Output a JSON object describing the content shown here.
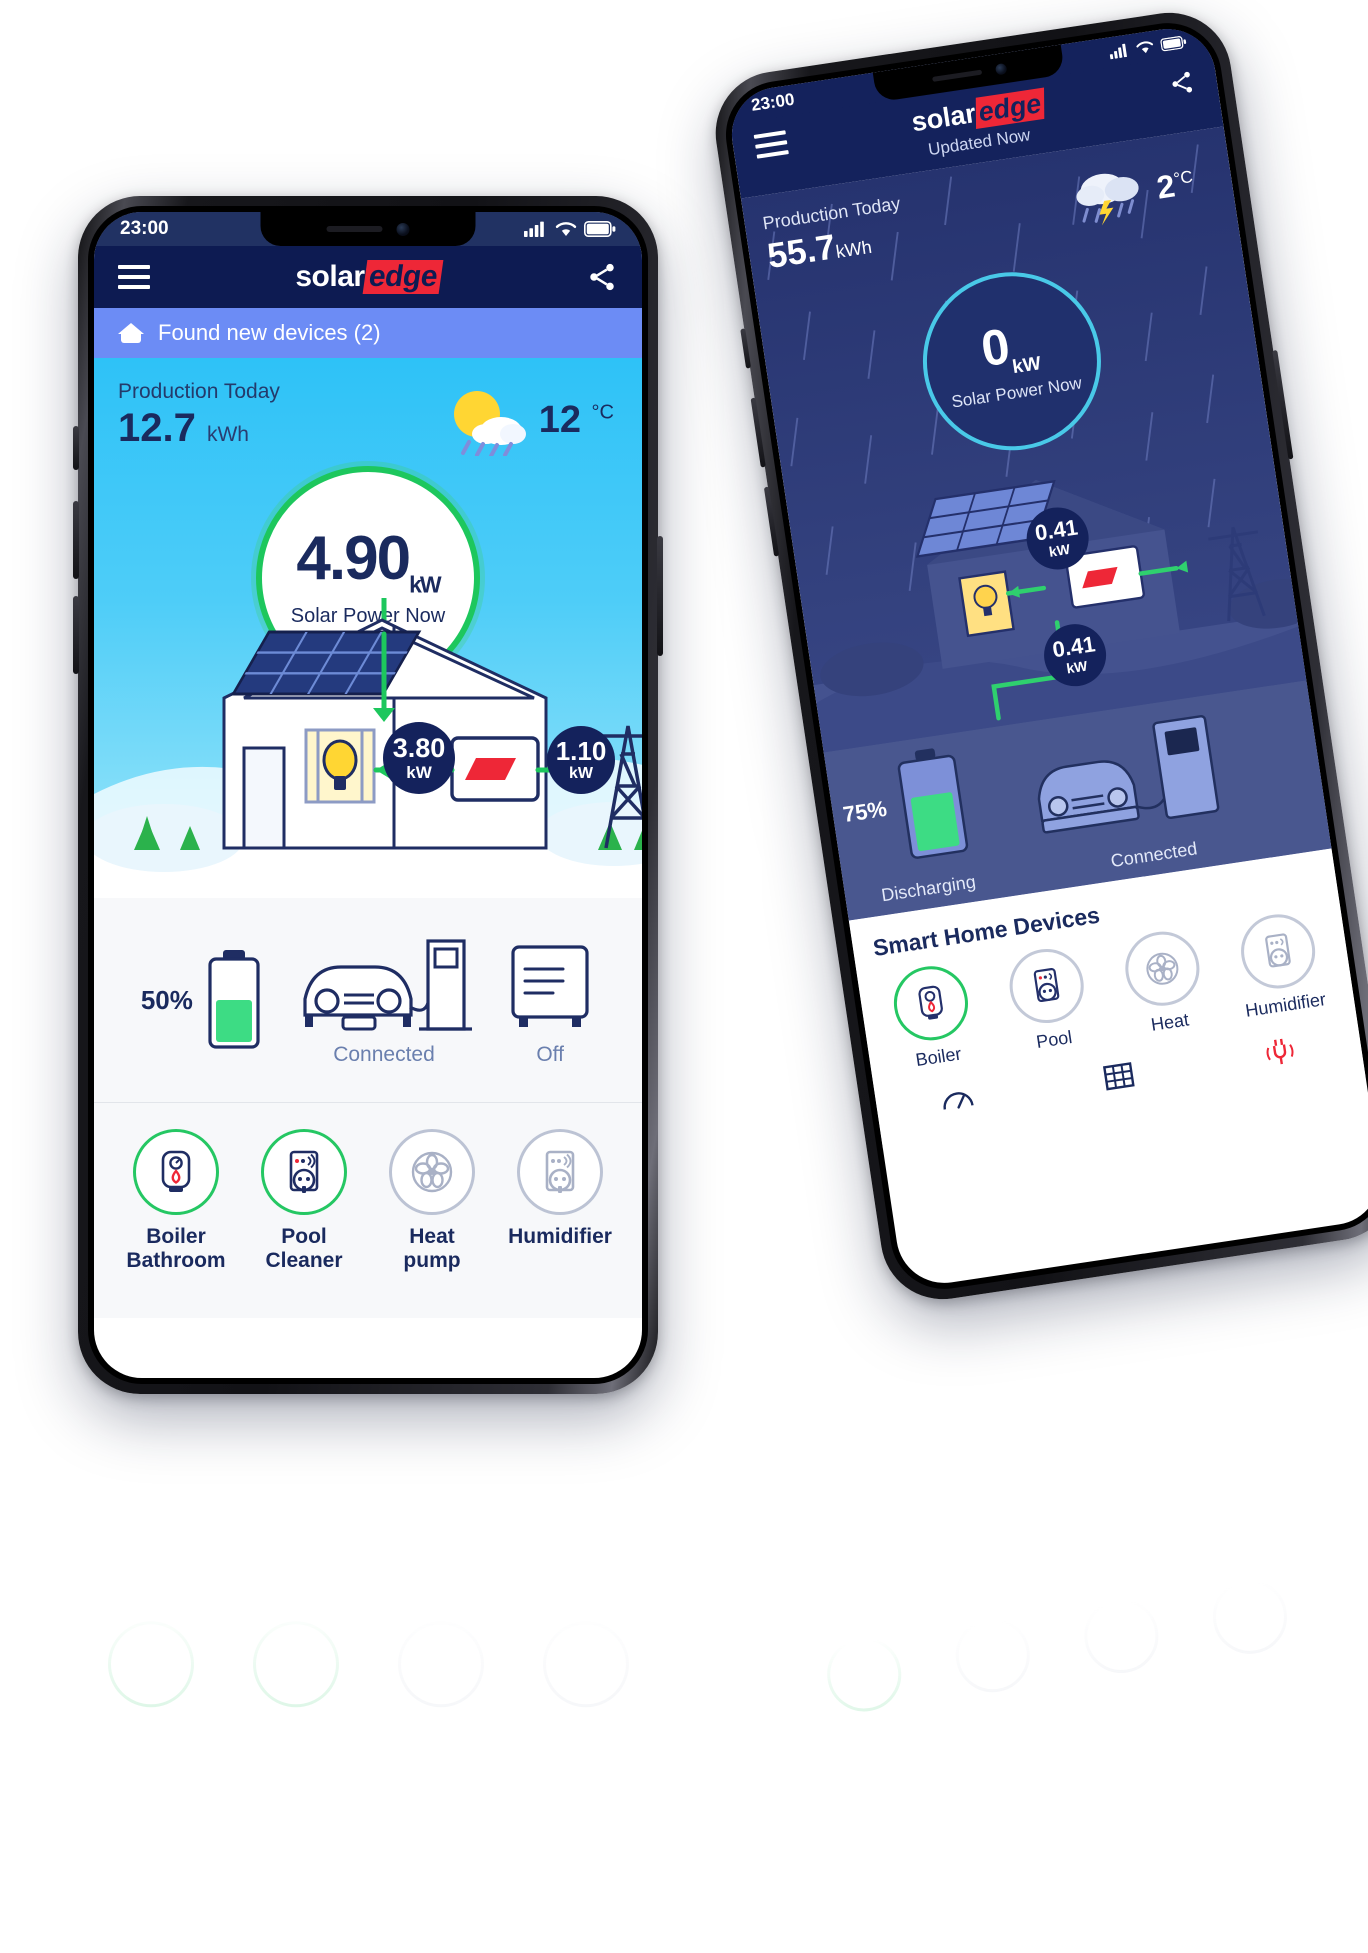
{
  "front_phone": {
    "status_bar": {
      "time": "23:00",
      "signal_icon": "cellular-signal-icon",
      "wifi_icon": "wifi-icon",
      "battery_icon": "battery-icon"
    },
    "navbar": {
      "menu_icon": "hamburger-menu-icon",
      "logo_part1": "solar",
      "logo_part2": "edge",
      "share_icon": "share-icon"
    },
    "banner": {
      "icon": "house-icon",
      "text": "Found new devices (2)"
    },
    "production": {
      "label": "Production Today",
      "value": "12.7",
      "unit": "kWh"
    },
    "weather": {
      "icon": "sun-cloud-rain-icon",
      "temperature": "12",
      "unit": "°C"
    },
    "power_circle": {
      "value": "4.90",
      "unit": "kW",
      "label": "Solar Power Now",
      "ring_color": "#1dc75d"
    },
    "flow": {
      "home_badge": {
        "value": "3.80",
        "unit": "kW"
      },
      "grid_badge": {
        "value": "1.10",
        "unit": "kW"
      },
      "inverter_icon": "inverter-icon",
      "solar_panel_icon": "solar-panel-icon",
      "light_bulb_icon": "light-bulb-icon",
      "pylon_icon": "power-pylon-icon"
    },
    "devices": [
      {
        "name": "battery",
        "icon": "battery-storage-icon",
        "value": "50%",
        "label": ""
      },
      {
        "name": "ev-charger",
        "icon": "ev-car-charger-icon",
        "value": "",
        "label": "Connected"
      },
      {
        "name": "inverter-unit",
        "icon": "inverter-unit-icon",
        "value": "",
        "label": "Off"
      }
    ],
    "smart_devices": [
      {
        "icon": "boiler-icon",
        "label": "Boiler\nBathroom",
        "label_line1": "Boiler",
        "label_line2": "Bathroom",
        "active": true
      },
      {
        "icon": "smart-plug-icon",
        "label": "Pool Cleaner",
        "label_line1": "Pool",
        "label_line2": "Cleaner",
        "active": true
      },
      {
        "icon": "fan-icon",
        "label": "Heat pump",
        "label_line1": "Heat",
        "label_line2": "pump",
        "active": false
      },
      {
        "icon": "smart-plug-icon",
        "label": "Humidifier",
        "label_line1": "Humidifier",
        "label_line2": "",
        "active": false
      }
    ]
  },
  "back_phone": {
    "status_bar": {
      "time": "23:00",
      "signal_icon": "cellular-signal-icon",
      "wifi_icon": "wifi-icon",
      "battery_icon": "battery-icon"
    },
    "navbar": {
      "menu_icon": "hamburger-menu-icon",
      "logo_part1": "solar",
      "logo_part2": "edge",
      "share_icon": "share-icon"
    },
    "updated": "Updated Now",
    "production": {
      "label": "Production Today",
      "value": "55.7",
      "unit": "kWh"
    },
    "weather": {
      "icon": "storm-cloud-icon",
      "temperature": "2",
      "unit": "°C"
    },
    "power_circle": {
      "value": "0",
      "unit": "kW",
      "label": "Solar Power Now",
      "ring_color": "#49c9e8"
    },
    "flow": {
      "home_badge": {
        "value": "0.41",
        "unit": "kW"
      },
      "battery_badge": {
        "value": "0.41",
        "unit": "kW"
      }
    },
    "devices": [
      {
        "name": "battery",
        "value": "75%",
        "label": "Discharging"
      },
      {
        "name": "ev-charger",
        "value": "",
        "label": "Connected"
      }
    ],
    "smart_section_title": "Smart Home Devices",
    "smart_devices": [
      {
        "icon": "boiler-icon",
        "label": "Boiler",
        "active": true
      },
      {
        "icon": "smart-plug-icon",
        "label": "Pool",
        "active": false
      },
      {
        "icon": "fan-icon",
        "label": "Heat",
        "active": false
      },
      {
        "icon": "smart-plug-icon",
        "label": "Humidifier",
        "active": false
      }
    ],
    "tabs": [
      {
        "icon": "gauge-icon",
        "active": false
      },
      {
        "icon": "grid-panels-icon",
        "active": false
      },
      {
        "icon": "plug-icon",
        "active": true
      }
    ]
  },
  "colors": {
    "brand_navy": "#0d1b52",
    "brand_red": "#ee2737",
    "accent_green": "#1dc75d",
    "banner_blue": "#6c8cf5",
    "sky_blue": "#2ec2f7"
  }
}
